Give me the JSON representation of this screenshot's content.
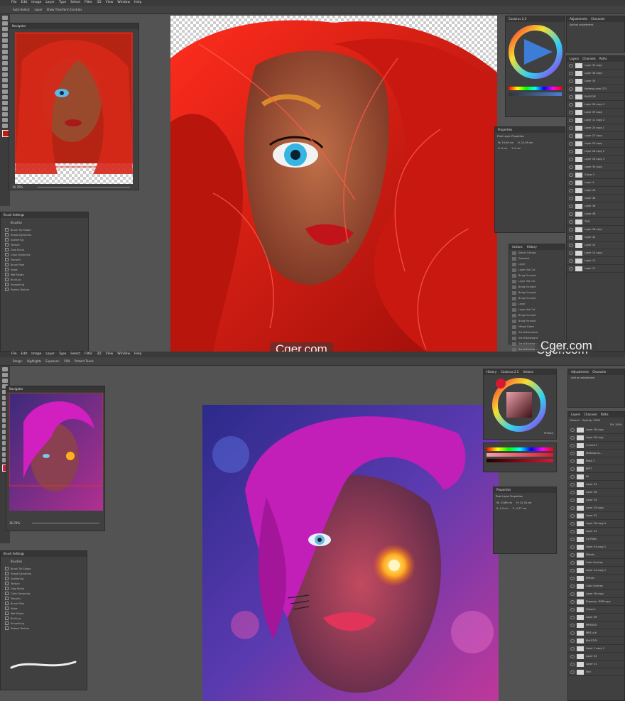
{
  "menu": [
    "File",
    "Edit",
    "Image",
    "Layer",
    "Type",
    "Select",
    "Filter",
    "3D",
    "View",
    "Window",
    "Help"
  ],
  "top": {
    "options": [
      "Auto-Select:",
      "Layer",
      "Show Transform Controls"
    ],
    "navigator": {
      "title": "Navigator",
      "zoom": "16,70%"
    },
    "brush_settings": {
      "title": "Brush Settings",
      "tab": "Brushes",
      "items": [
        "Brush Tip Shape",
        "Shape Dynamics",
        "Scattering",
        "Texture",
        "Dual Brush",
        "Color Dynamics",
        "Transfer",
        "Brush Pose",
        "Noise",
        "Wet Edges",
        "Build-up",
        "Smoothing",
        "Protect Texture"
      ]
    },
    "coolorus": {
      "tabs": [
        "Coolorus 2.5",
        "Actions"
      ]
    },
    "properties": {
      "title": "Properties",
      "sub": "Pixel Layer Properties",
      "w": "W: 19,56 cm",
      "h": "H: 21,99 cm",
      "x": "X: 0 cm",
      "y": "Y: 0 cm"
    },
    "adjustments": {
      "tabs": [
        "Adjustments",
        "Character"
      ],
      "add": "Add an adjustment"
    },
    "layers": {
      "tabs": [
        "Layers",
        "Channels",
        "Paths"
      ],
      "items": [
        "Layer 35 copy",
        "Layer 36 copy",
        "Layer 34",
        "fadeeup.com (37)",
        "Rb0222K",
        "Layer 28 copy 2",
        "Layer 39 copy",
        "Layer 11 copy 2",
        "Layer 24 copy 2",
        "Layer 27 copy",
        "Layer 29 copy",
        "Layer 28 copy 2",
        "Layer 26 copy 3",
        "Layer 30 copy",
        "Group 3",
        "Layer 4",
        "Layer 44",
        "Layer 46",
        "Layer 36",
        "Layer 46",
        "TRD",
        "Layer 28 copy",
        "Layer 44",
        "Layer 15",
        "Layer 14 copy",
        "Layer 13",
        "Layer 12"
      ]
    },
    "history": {
      "tabs": [
        "Actions",
        "History"
      ],
      "items": [
        "Select Canvas",
        "Deselect",
        "Layer",
        "Layer Via Cut",
        "Bring Forward",
        "Layer Via Cut",
        "Bring Forward",
        "Bring Forward",
        "Bring Forward",
        "Layer",
        "Layer Via Cut",
        "Bring Forward",
        "Bring Forward",
        "Merge Down",
        "Send Backward",
        "Send Backward",
        "Send Backward",
        "Send Backward"
      ]
    },
    "watermark": "Cger.com"
  },
  "bottom": {
    "options": [
      "Range:",
      "Highlights",
      "Exposure:",
      "50%",
      "Protect Tones"
    ],
    "navigator": {
      "title": "Navigator",
      "zoom": "36,78%"
    },
    "brush_settings": {
      "title": "Brush Settings",
      "tab": "Brushes",
      "items": [
        "Brush Tip Shape",
        "Shape Dynamics",
        "Scattering",
        "Texture",
        "Dual Brush",
        "Color Dynamics",
        "Transfer",
        "Brush Pose",
        "Noise",
        "Wet Edges",
        "Build-up",
        "Smoothing",
        "Protect Texture"
      ]
    },
    "coolorus": {
      "tabs": [
        "History",
        "Coolorus 2.5",
        "Actions"
      ],
      "hex": "FF0024"
    },
    "properties": {
      "title": "Properties",
      "sub": "Pixel Layer Properties",
      "w": "W: 23,89 cm",
      "h": "H: 31,34 cm",
      "x": "X: 1,9 cm",
      "y": "Y: -4,77 cm"
    },
    "adjustments": {
      "tabs": [
        "Adjustments",
        "Character"
      ],
      "add": "Add an adjustment"
    },
    "layers": {
      "tabs": [
        "Layers",
        "Channels",
        "Paths"
      ],
      "blend": "Normal",
      "opacity": "Opacity: 100%",
      "fill": "Fill: 100%",
      "items": [
        "Layer 38 copy",
        "Layer 36 copy",
        "Current 2",
        "fadeeup.co...",
        "Mask 2",
        "BRTT",
        "fill",
        "Layer 34",
        "Layer 36",
        "Layer 35",
        "Layer 35 copy",
        "Layer 33",
        "Layer 36 copy 4",
        "Layer 34",
        "OUTRNG",
        "Layer 34 copy 2",
        "Effects",
        "Color Overlay",
        "Layer 34 copy 2",
        "Effects",
        "Color Overlay",
        "Layer 36 copy",
        "Property...RGB copy",
        "Group 1",
        "Layer 36",
        "MRN1RO",
        "MRE_cut",
        "Bk4G2Z4",
        "Layer 2 copy 2",
        "Layer 32",
        "Layer 31",
        "Skin"
      ]
    },
    "watermark": "Cger.com"
  },
  "colors": {
    "hair_red": "#c41a12",
    "hair_magenta": "#c61bb8",
    "skin": "#a4573a",
    "bg_dark": "#535353"
  }
}
